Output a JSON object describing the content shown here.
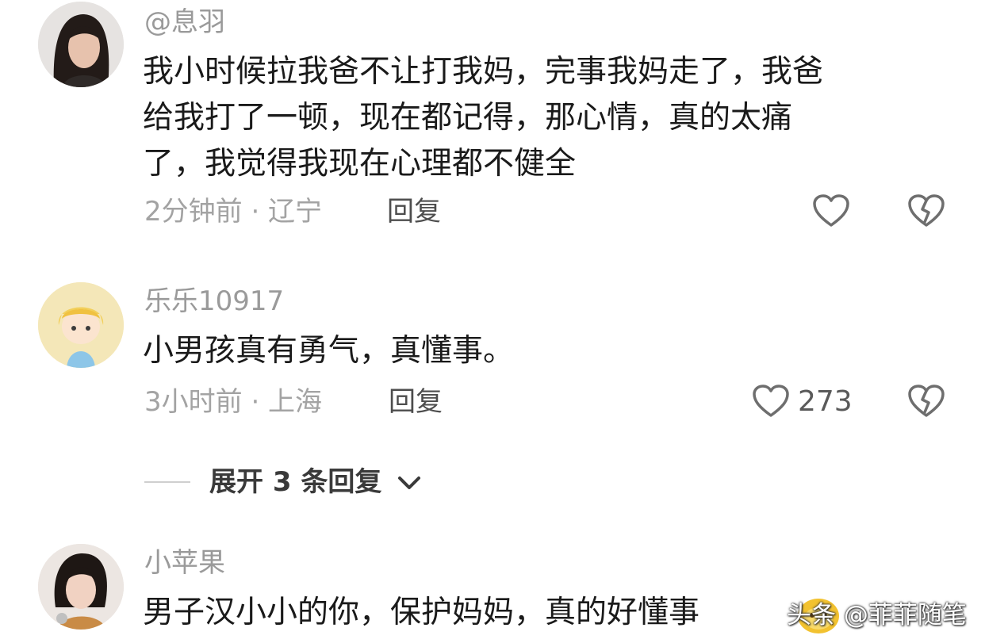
{
  "comments": [
    {
      "username": "@息羽",
      "lines": [
        "我小时候拉我爸不让打我妈，完事我妈走了，我爸",
        "给我打了一顿，现在都记得，那心情，真的太痛",
        "了，我觉得我现在心理都不健全"
      ],
      "meta": "2分钟前 · 辽宁",
      "reply": "回复",
      "avatar_icon": "woman-portrait-avatar"
    },
    {
      "username": "乐乐10917",
      "lines": [
        "小男孩真有勇气，真懂事。"
      ],
      "meta": "3小时前 · 上海",
      "reply": "回复",
      "like_count": "273",
      "avatar_icon": "cartoon-girl-avatar"
    },
    {
      "username": "小苹果",
      "lines": [
        "男子汉小小的你，保护妈妈，真的好懂事"
      ],
      "avatar_icon": "woman-portrait-avatar"
    }
  ],
  "expand": {
    "label": "展开 3 条回复"
  },
  "watermark": {
    "text": "头条 @菲菲随笔"
  },
  "colors": {
    "accent": "#f2c230",
    "icon": "#6e6e6e"
  }
}
